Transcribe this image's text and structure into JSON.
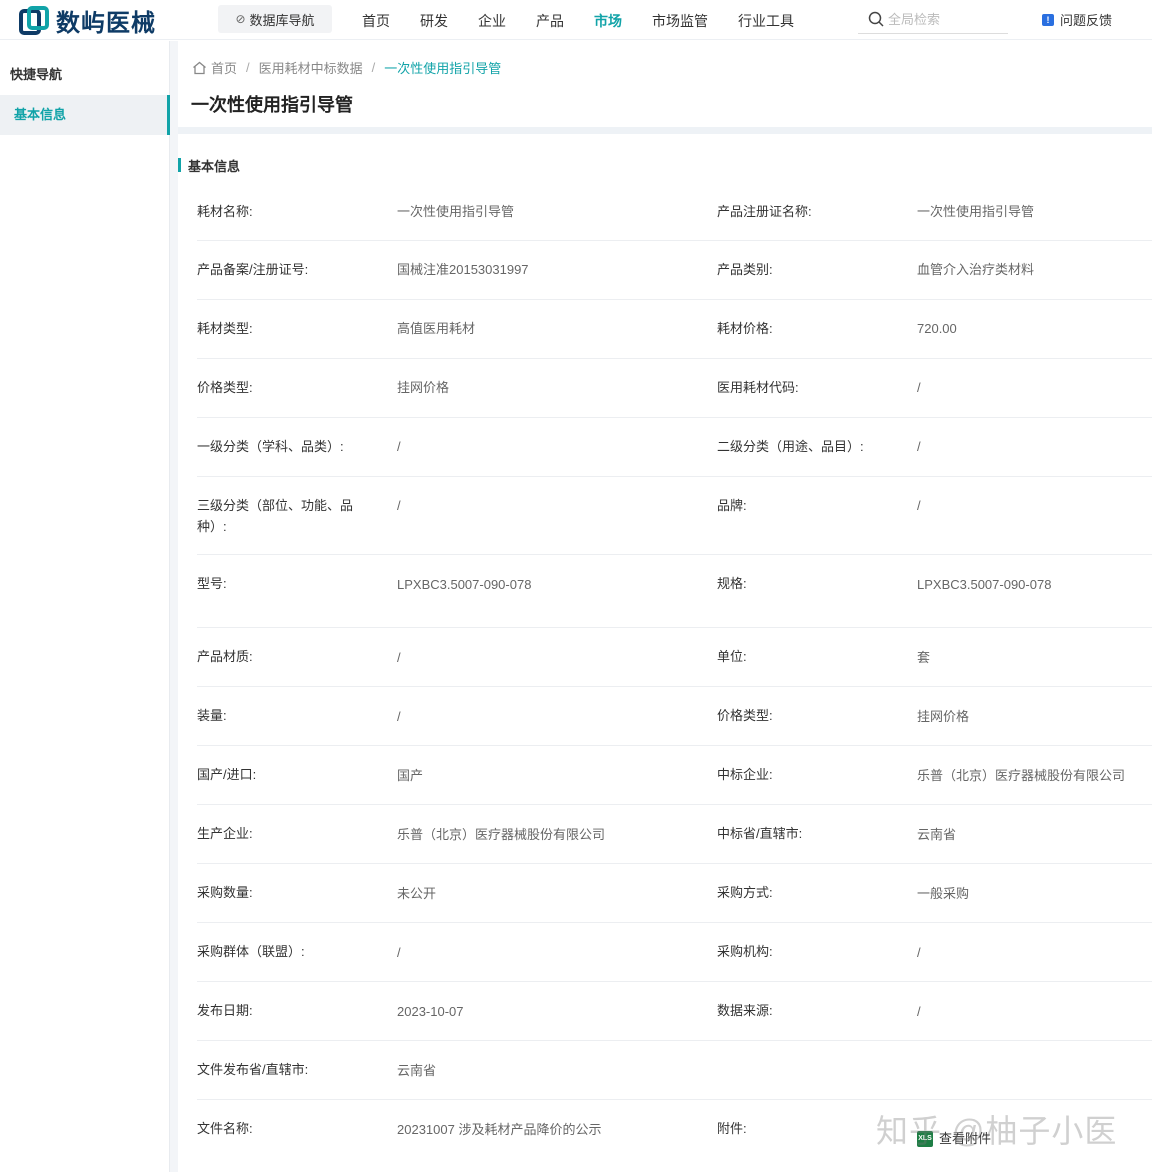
{
  "brand": {
    "name": "数屿医械"
  },
  "topnav": {
    "db_nav": "数据库导航",
    "items": [
      "首页",
      "研发",
      "企业",
      "产品",
      "市场",
      "市场监管",
      "行业工具"
    ],
    "active": "市场",
    "search_placeholder": "全局检索",
    "feedback": "问题反馈"
  },
  "sidebar": {
    "title": "快捷导航",
    "items": [
      {
        "label": "基本信息"
      }
    ]
  },
  "breadcrumb": [
    "首页",
    "医用耗材中标数据",
    "一次性使用指引导管"
  ],
  "page_title": "一次性使用指引导管",
  "section_title": "基本信息",
  "rows": [
    {
      "l1": "耗材名称:",
      "v1": "一次性使用指引导管",
      "l2": "产品注册证名称:",
      "v2": "一次性使用指引导管"
    },
    {
      "l1": "产品备案/注册证号:",
      "v1": "国械注准20153031997",
      "l2": "产品类别:",
      "v2": "血管介入治疗类材料"
    },
    {
      "l1": "耗材类型:",
      "v1": "高值医用耗材",
      "l2": "耗材价格:",
      "v2": "720.00"
    },
    {
      "l1": "价格类型:",
      "v1": "挂网价格",
      "l2": "医用耗材代码:",
      "v2": "/"
    },
    {
      "l1": "一级分类（学科、品类）:",
      "v1": "/",
      "l2": "二级分类（用途、品目）:",
      "v2": "/"
    },
    {
      "l1": "三级分类（部位、功能、品种）:",
      "v1": "/",
      "l2": "品牌:",
      "v2": "/"
    },
    {
      "l1": "型号:",
      "v1": "LPXBC3.5007-090-078",
      "l2": "规格:",
      "v2": "LPXBC3.5007-090-078"
    },
    {
      "l1": "产品材质:",
      "v1": "/",
      "l2": "单位:",
      "v2": "套"
    },
    {
      "l1": "装量:",
      "v1": "/",
      "l2": "价格类型:",
      "v2": "挂网价格"
    },
    {
      "l1": "国产/进口:",
      "v1": "国产",
      "l2": "中标企业:",
      "v2": "乐普（北京）医疗器械股份有限公司"
    },
    {
      "l1": "生产企业:",
      "v1": "乐普（北京）医疗器械股份有限公司",
      "l2": "中标省/直辖市:",
      "v2": "云南省"
    },
    {
      "l1": "采购数量:",
      "v1": "未公开",
      "l2": "采购方式:",
      "v2": "一般采购"
    },
    {
      "l1": "采购群体（联盟）:",
      "v1": "/",
      "l2": "采购机构:",
      "v2": "/"
    },
    {
      "l1": "发布日期:",
      "v1": "2023-10-07",
      "l2": "数据来源:",
      "v2": "/"
    },
    {
      "l1": "文件发布省/直辖市:",
      "v1": "云南省",
      "l2": "",
      "v2": ""
    },
    {
      "l1": "文件名称:",
      "v1": "20231007 涉及耗材产品降价的公示",
      "l2": "附件:",
      "v2": "查看附件"
    }
  ],
  "watermark": "知乎 @柚子小医",
  "colors": {
    "accent": "#11a3a8",
    "brand": "#0e3b66"
  }
}
